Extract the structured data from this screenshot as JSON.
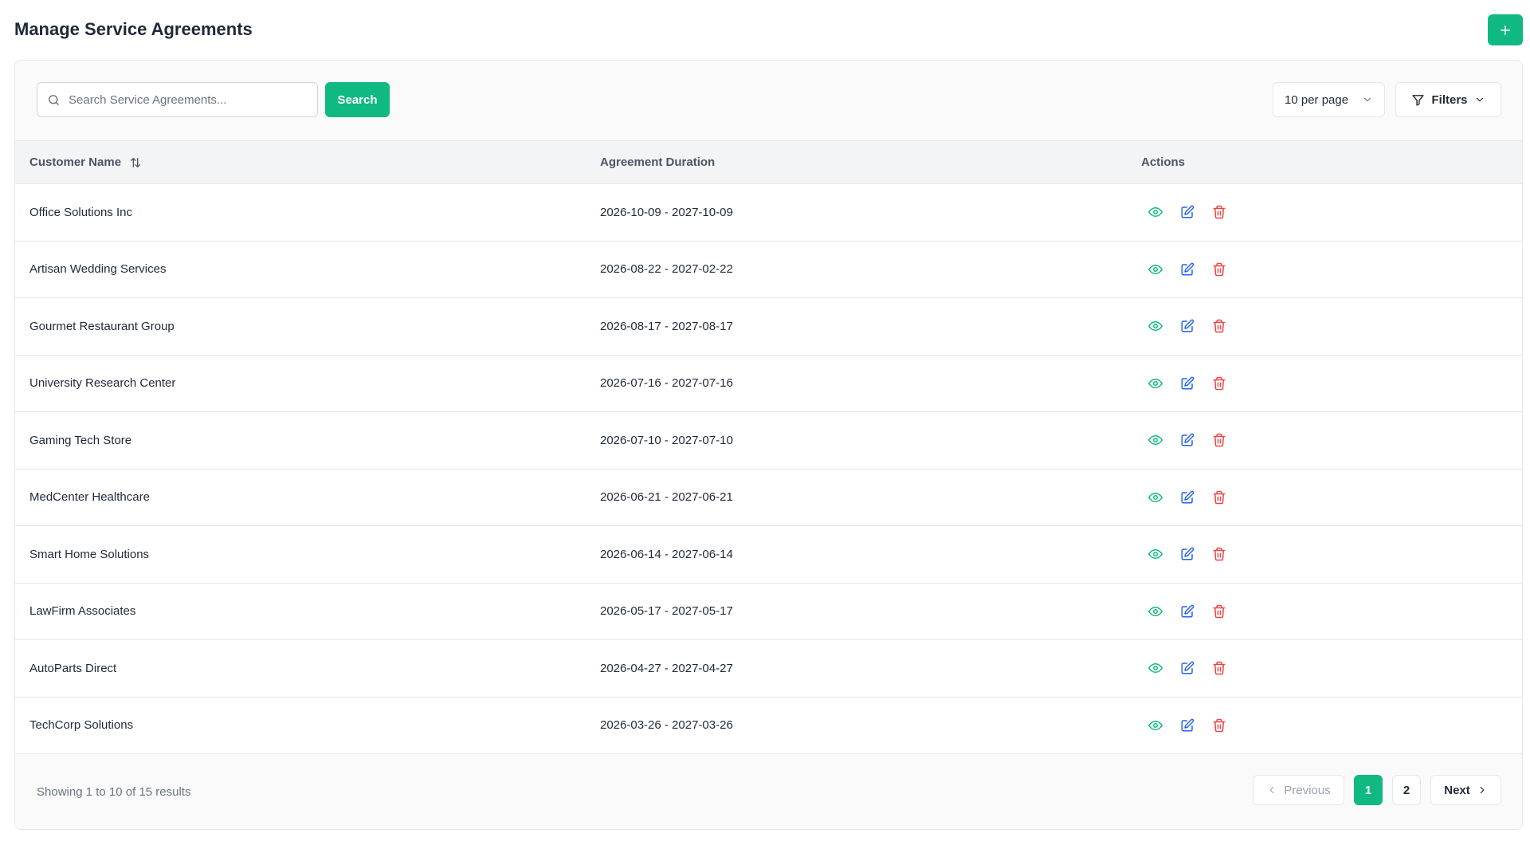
{
  "header": {
    "title": "Manage Service Agreements",
    "add_icon": "plus-icon"
  },
  "toolbar": {
    "search_placeholder": "Search Service Agreements...",
    "search_label": "Search",
    "per_page_label": "10 per page",
    "filters_label": "Filters"
  },
  "table": {
    "columns": [
      "Customer Name",
      "Agreement Duration",
      "Actions"
    ],
    "rows": [
      {
        "name": "Office Solutions Inc",
        "duration": "2026-10-09 - 2027-10-09"
      },
      {
        "name": "Artisan Wedding Services",
        "duration": "2026-08-22 - 2027-02-22"
      },
      {
        "name": "Gourmet Restaurant Group",
        "duration": "2026-08-17 - 2027-08-17"
      },
      {
        "name": "University Research Center",
        "duration": "2026-07-16 - 2027-07-16"
      },
      {
        "name": "Gaming Tech Store",
        "duration": "2026-07-10 - 2027-07-10"
      },
      {
        "name": "MedCenter Healthcare",
        "duration": "2026-06-21 - 2027-06-21"
      },
      {
        "name": "Smart Home Solutions",
        "duration": "2026-06-14 - 2027-06-14"
      },
      {
        "name": "LawFirm Associates",
        "duration": "2026-05-17 - 2027-05-17"
      },
      {
        "name": "AutoParts Direct",
        "duration": "2026-04-27 - 2027-04-27"
      },
      {
        "name": "TechCorp Solutions",
        "duration": "2026-03-26 - 2027-03-26"
      }
    ]
  },
  "footer": {
    "summary": "Showing 1 to 10 of 15 results",
    "previous_label": "Previous",
    "next_label": "Next",
    "pages": [
      "1",
      "2"
    ]
  },
  "colors": {
    "accent": "#10b981",
    "view": "#10b981",
    "edit": "#2563eb",
    "delete": "#ef4444"
  }
}
